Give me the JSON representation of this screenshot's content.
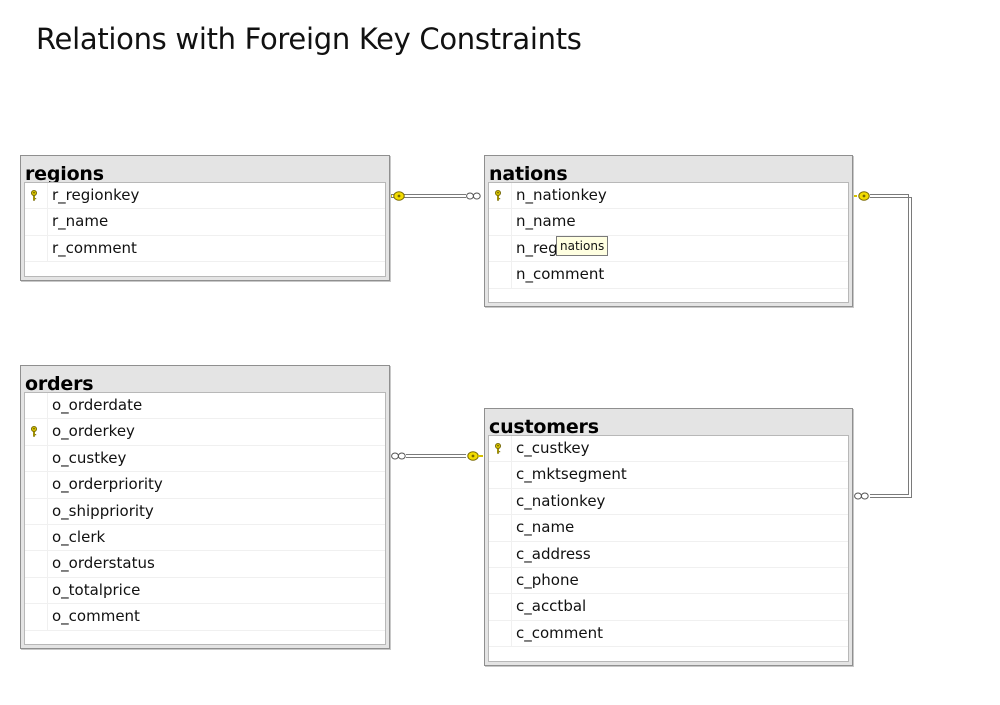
{
  "title": "Relations with Foreign Key Constraints",
  "tables": {
    "regions": {
      "name": "regions",
      "columns": [
        {
          "name": "r_regionkey",
          "primary_key": true
        },
        {
          "name": "r_name",
          "primary_key": false
        },
        {
          "name": "r_comment",
          "primary_key": false
        }
      ]
    },
    "nations": {
      "name": "nations",
      "columns": [
        {
          "name": "n_nationkey",
          "primary_key": true
        },
        {
          "name": "n_name",
          "primary_key": false
        },
        {
          "name": "n_regi",
          "primary_key": false
        },
        {
          "name": "n_comment",
          "primary_key": false
        }
      ]
    },
    "orders": {
      "name": "orders",
      "columns": [
        {
          "name": "o_orderdate",
          "primary_key": false
        },
        {
          "name": "o_orderkey",
          "primary_key": true
        },
        {
          "name": "o_custkey",
          "primary_key": false
        },
        {
          "name": "o_orderpriority",
          "primary_key": false
        },
        {
          "name": "o_shippriority",
          "primary_key": false
        },
        {
          "name": "o_clerk",
          "primary_key": false
        },
        {
          "name": "o_orderstatus",
          "primary_key": false
        },
        {
          "name": "o_totalprice",
          "primary_key": false
        },
        {
          "name": "o_comment",
          "primary_key": false
        }
      ]
    },
    "customers": {
      "name": "customers",
      "columns": [
        {
          "name": "c_custkey",
          "primary_key": true
        },
        {
          "name": "c_mktsegment",
          "primary_key": false
        },
        {
          "name": "c_nationkey",
          "primary_key": false
        },
        {
          "name": "c_name",
          "primary_key": false
        },
        {
          "name": "c_address",
          "primary_key": false
        },
        {
          "name": "c_phone",
          "primary_key": false
        },
        {
          "name": "c_acctbal",
          "primary_key": false
        },
        {
          "name": "c_comment",
          "primary_key": false
        }
      ]
    }
  },
  "tooltip": "nations",
  "colors": {
    "key_icon": "#d4c000",
    "connector_line": "#7a7a7a",
    "header_bg": "#e4e4e4",
    "tooltip_bg": "#ffffe1"
  },
  "relationships": [
    {
      "from_table": "nations",
      "to_table": "regions",
      "cardinality": "many-to-one"
    },
    {
      "from_table": "orders",
      "to_table": "customers",
      "cardinality": "many-to-one"
    },
    {
      "from_table": "customers",
      "to_table": "nations",
      "cardinality": "many-to-one"
    }
  ]
}
